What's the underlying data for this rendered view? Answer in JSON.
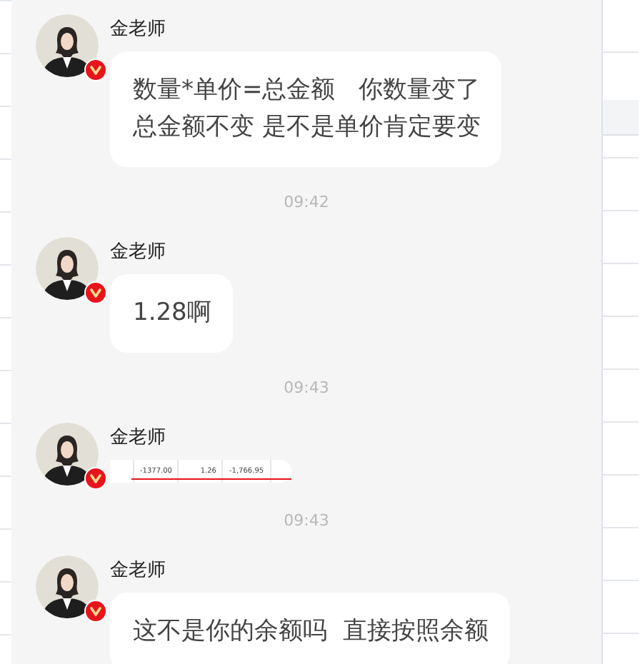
{
  "messages": [
    {
      "kind": "text",
      "sender": "金老师",
      "verified": true,
      "lines": [
        "数量*单价=总金额   你数量变了",
        "总金额不变 是不是单价肯定要变"
      ]
    },
    {
      "kind": "time",
      "text": "09:42"
    },
    {
      "kind": "text",
      "sender": "金老师",
      "verified": true,
      "lines": [
        "1.28啊"
      ]
    },
    {
      "kind": "time",
      "text": "09:43"
    },
    {
      "kind": "image",
      "sender": "金老师",
      "verified": true,
      "cells": [
        "-1377.00",
        "1.26",
        "-1,766.95"
      ]
    },
    {
      "kind": "time",
      "text": "09:43"
    },
    {
      "kind": "text",
      "sender": "金老师",
      "verified": true,
      "lines": [
        "这不是你的余额吗  直接按照余额"
      ]
    }
  ]
}
